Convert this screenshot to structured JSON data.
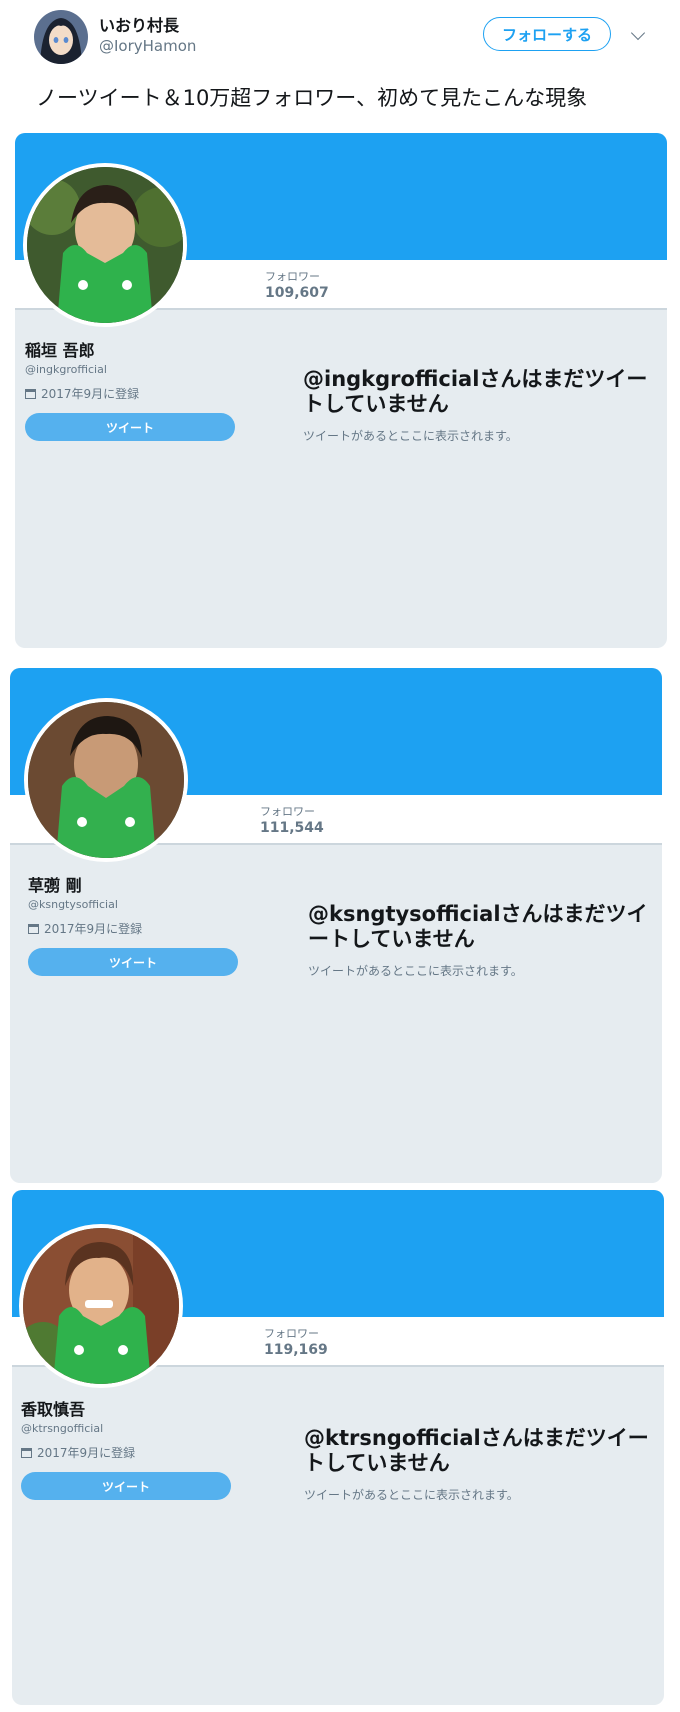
{
  "tweet": {
    "author_name": "いおり村長",
    "author_handle": "@IoryHamon",
    "follow_label": "フォローする",
    "text": "ノーツイート＆10万超フォロワー、初めて見たこんな現象"
  },
  "profiles": [
    {
      "name": "稲垣 吾郎",
      "handle": "@ingkgrofficial",
      "followers_label": "フォロワー",
      "followers": "109,607",
      "joined": "2017年9月に登録",
      "tweet_button": "ツイート",
      "empty_title": "@ingkgrofficialさんはまだツイートしていません",
      "empty_sub": "ツイートがあるとここに表示されます。"
    },
    {
      "name": "草彅 剛",
      "handle": "@ksngtysofficial",
      "followers_label": "フォロワー",
      "followers": "111,544",
      "joined": "2017年9月に登録",
      "tweet_button": "ツイート",
      "empty_title": "@ksngtysofficialさんはまだツイートしていません",
      "empty_sub": "ツイートがあるとここに表示されます。"
    },
    {
      "name": "香取慎吾",
      "handle": "@ktrsngofficial",
      "followers_label": "フォロワー",
      "followers": "119,169",
      "joined": "2017年9月に登録",
      "tweet_button": "ツイート",
      "empty_title": "@ktrsngofficialさんはまだツイートしていません",
      "empty_sub": "ツイートがあるとここに表示されます。"
    }
  ],
  "colors": {
    "accent": "#1da1f2",
    "card_bg": "#e6ecf0",
    "muted": "#657786"
  },
  "icons": [
    "chevron-down-icon",
    "calendar-icon"
  ]
}
